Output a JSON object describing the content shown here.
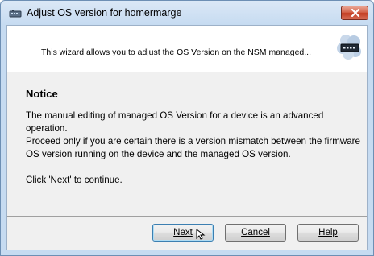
{
  "window": {
    "title": "Adjust OS version for homermarge",
    "app_icon": "network-device-icon",
    "close_icon": "close-icon"
  },
  "header": {
    "subtitle": "This wizard allows you to adjust the OS Version on the NSM managed...",
    "icon": "network-device-icon"
  },
  "content": {
    "notice_title": "Notice",
    "paragraph1": "The manual editing of managed OS Version for a device is an advanced operation.",
    "paragraph2": "Proceed only if you are certain there is a version mismatch between the firmware OS version running on the device and the managed OS version.",
    "paragraph3": "Click 'Next' to continue."
  },
  "buttons": {
    "next_label": "Next",
    "cancel_label": "Cancel",
    "help_label": "Help"
  },
  "colors": {
    "title_bar": "#c6dbf1",
    "close_button": "#c23b20",
    "default_button_border": "#3c7fb1"
  }
}
